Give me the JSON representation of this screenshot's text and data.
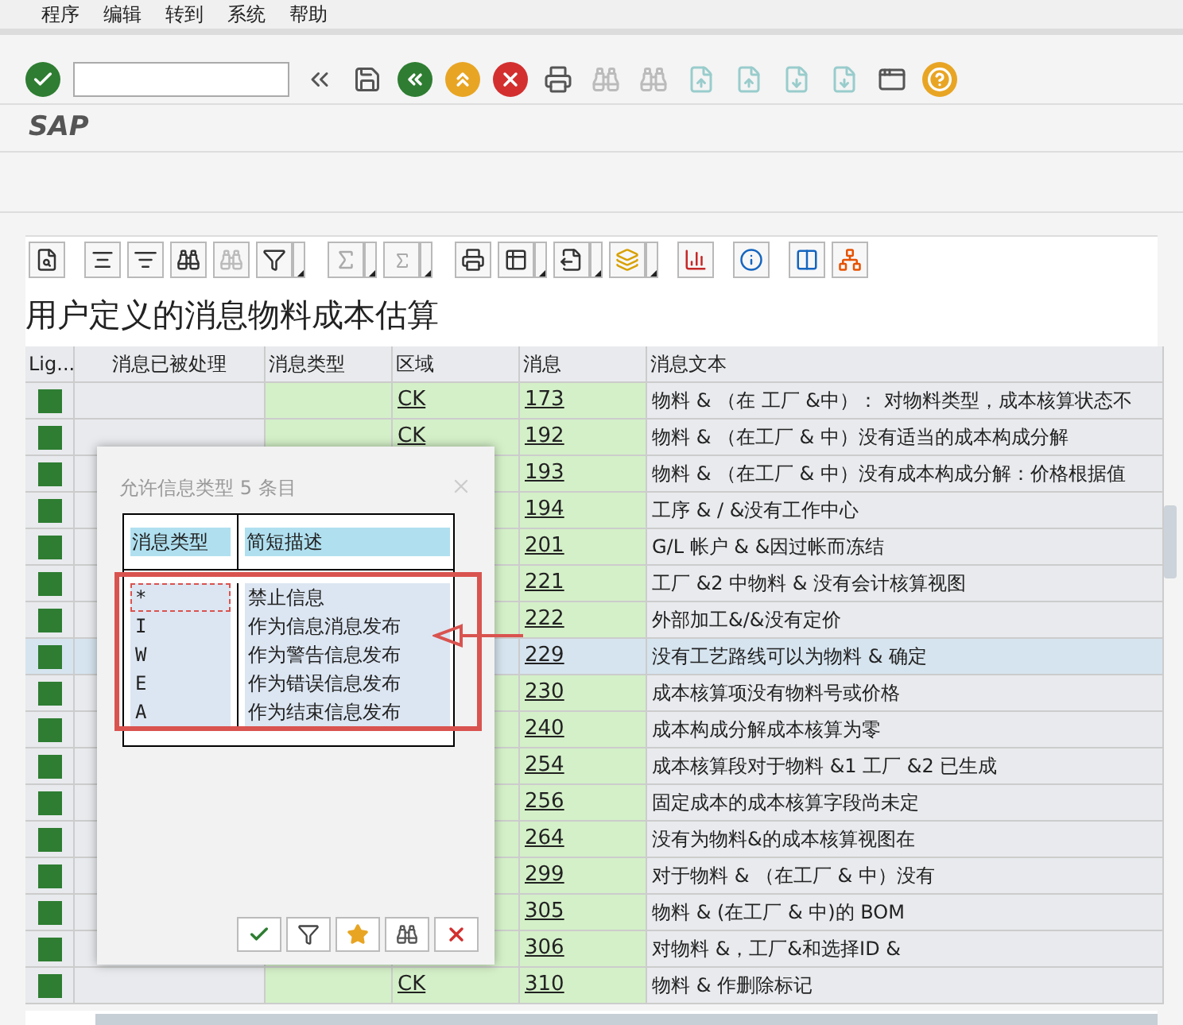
{
  "menu": [
    "程序",
    "编辑",
    "转到",
    "系统",
    "帮助"
  ],
  "app_title": "SAP",
  "report_title": "用户定义的消息物料成本估算",
  "table": {
    "columns": [
      "Lig...",
      "消息已被处理",
      "消息类型",
      "区域",
      "消息",
      "消息文本"
    ],
    "rows": [
      {
        "area": "CK",
        "message": "173",
        "text": "物料 & （在 工厂 &中）： 对物料类型，成本核算状态不",
        "selected": false
      },
      {
        "area": "CK",
        "message": "192",
        "text": "物料 & （在工厂 & 中）没有适当的成本构成分解",
        "selected": false
      },
      {
        "message": "193",
        "text": "物料 & （在工厂 & 中）没有成本构成分解：价格根据值",
        "selected": false
      },
      {
        "message": "194",
        "text": "工序 & / &没有工作中心",
        "selected": false
      },
      {
        "message": "201",
        "text": "G/L 帐户 & &因过帐而冻结",
        "selected": false
      },
      {
        "message": "221",
        "text": "工厂 &2 中物料 & 没有会计核算视图",
        "selected": false
      },
      {
        "message": "222",
        "text": "外部加工&/&没有定价",
        "selected": false
      },
      {
        "message": "229",
        "text": "没有工艺路线可以为物料 & 确定",
        "selected": true
      },
      {
        "message": "230",
        "text": "成本核算项没有物料号或价格",
        "selected": false
      },
      {
        "message": "240",
        "text": "成本构成分解成本核算为零",
        "selected": false
      },
      {
        "message": "254",
        "text": "成本核算段对于物料 &1 工厂 &2 已生成",
        "selected": false
      },
      {
        "message": "256",
        "text": "固定成本的成本核算字段尚未定",
        "selected": false
      },
      {
        "message": "264",
        "text": "没有为物料&的成本核算视图在",
        "selected": false
      },
      {
        "message": "299",
        "text": "对于物料 & （在工厂 & 中）没有",
        "selected": false
      },
      {
        "message": "305",
        "text": "物料 & (在工厂 & 中)的 BOM",
        "selected": false
      },
      {
        "message": "306",
        "text": "对物料 &，工厂&和选择ID &",
        "selected": false
      },
      {
        "area": "CK",
        "message": "310",
        "text": "物料 & 作删除标记",
        "selected": false
      }
    ]
  },
  "dialog": {
    "title": "允许信息类型 5 条目",
    "columns": [
      "消息类型",
      "简短描述"
    ],
    "items": [
      {
        "code": "*",
        "description": "禁止信息",
        "focused": true
      },
      {
        "code": "I",
        "description": "作为信息消息发布",
        "focused": false
      },
      {
        "code": "W",
        "description": "作为警告信息发布",
        "focused": false
      },
      {
        "code": "E",
        "description": "作为错误信息发布",
        "focused": false
      },
      {
        "code": "A",
        "description": "作为结束信息发布",
        "focused": false
      }
    ]
  }
}
